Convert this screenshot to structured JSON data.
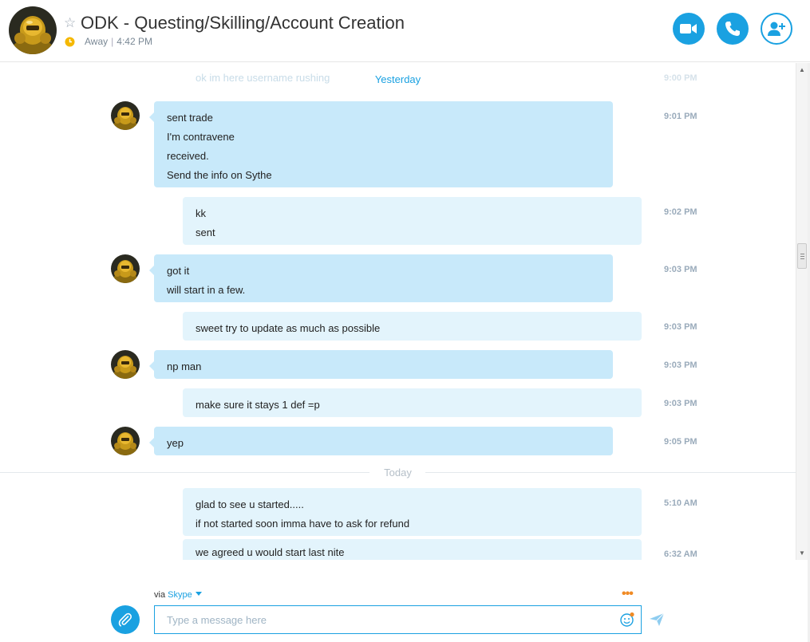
{
  "header": {
    "title": "ODK - Questing/Skilling/Account Creation",
    "status": "Away",
    "separator": "|",
    "time": "4:42 PM"
  },
  "messages": {
    "faded_text": "ok im here username rushing",
    "faded_time": "9:00 PM",
    "yesterday": "Yesterday",
    "today": "Today",
    "items": [
      {
        "sender": "them",
        "lines": [
          "sent trade",
          "I'm contravene",
          "received.",
          "Send the info on Sythe"
        ],
        "time": "9:01 PM"
      },
      {
        "sender": "me",
        "lines": [
          "kk",
          "sent"
        ],
        "time": "9:02 PM"
      },
      {
        "sender": "them",
        "lines": [
          "got it",
          "will start in a few."
        ],
        "time": "9:03 PM"
      },
      {
        "sender": "me",
        "lines": [
          "sweet try to update as much as possible"
        ],
        "time": "9:03 PM"
      },
      {
        "sender": "them",
        "lines": [
          "np man"
        ],
        "time": "9:03 PM"
      },
      {
        "sender": "me",
        "lines": [
          "make sure it stays 1 def =p"
        ],
        "time": "9:03 PM"
      },
      {
        "sender": "them",
        "lines": [
          "yep"
        ],
        "time": "9:05 PM"
      },
      {
        "sender": "me",
        "lines": [
          "glad to see u started.....",
          "if not started soon imma have to ask for refund"
        ],
        "time": "5:10 AM"
      },
      {
        "sender": "me",
        "lines": [
          "we agreed u would start last nite"
        ],
        "time": "6:32 AM"
      }
    ]
  },
  "composer": {
    "via_label": "via",
    "via_service": "Skype",
    "placeholder": "Type a message here",
    "more_label": "•••"
  },
  "icons": {
    "favorite": "star-outline-icon",
    "away": "clock-icon",
    "video": "video-camera-icon",
    "call": "phone-icon",
    "add": "add-person-icon",
    "attach": "paperclip-icon",
    "emoji": "emoticon-icon",
    "send": "send-arrow-icon"
  },
  "colors": {
    "accent": "#1aa1e1",
    "incoming_bubble": "#c8e9fa",
    "outgoing_bubble": "#e3f4fc",
    "away": "#f5b800"
  }
}
